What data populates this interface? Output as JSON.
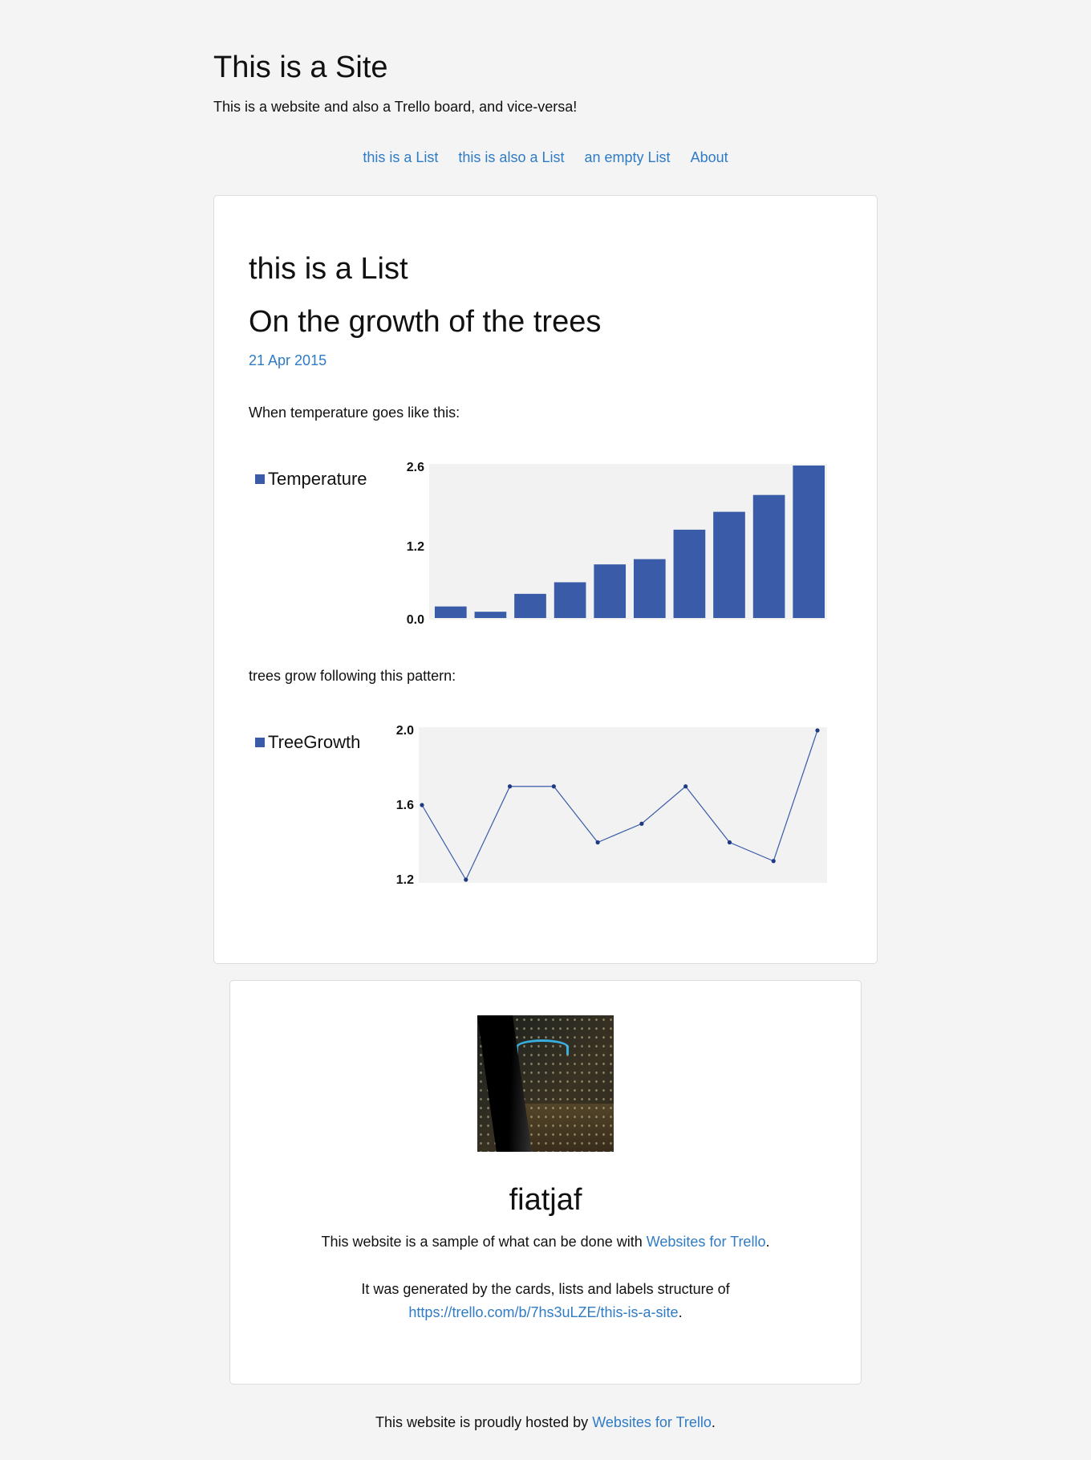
{
  "site": {
    "title": "This is a Site",
    "description": "This is a website and also a Trello board, and vice-versa!"
  },
  "nav": {
    "items": [
      "this is a List",
      "this is also a List",
      "an empty List",
      "About"
    ]
  },
  "list": {
    "title": "this is a List",
    "card": {
      "title": "On the growth of the trees",
      "date": "21 Apr 2015",
      "text1": "When temperature goes like this:",
      "text2": "trees grow following this pattern:"
    }
  },
  "chart_data": [
    {
      "type": "bar",
      "series": [
        {
          "name": "Temperature",
          "values": [
            0.22,
            0.12,
            0.46,
            0.68,
            1.02,
            1.12,
            1.68,
            2.02,
            2.34,
            2.9
          ]
        }
      ],
      "yticks": [
        "2.6",
        "1.2",
        "0.0"
      ],
      "ylim": [
        0,
        2.9
      ],
      "color": "#3a5ba8",
      "background": "#f2f2f2",
      "legend": "left"
    },
    {
      "type": "line",
      "series": [
        {
          "name": "TreeGrowth",
          "values": [
            1.6,
            1.2,
            1.7,
            1.7,
            1.4,
            1.5,
            1.7,
            1.4,
            1.3,
            2.0
          ]
        }
      ],
      "yticks": [
        "2.0",
        "1.6",
        "1.2"
      ],
      "ylim": [
        1.2,
        2.0
      ],
      "color": "#3a5ba8",
      "marker_color": "#1f3a82",
      "background": "#f2f2f2",
      "legend": "left"
    }
  ],
  "profile": {
    "name": "fiatjaf",
    "line1_prefix": "This website is a sample of what can be done with ",
    "line1_link": "Websites for Trello",
    "line1_suffix": ".",
    "line2_prefix": "It was generated by the cards, lists and labels structure of",
    "line2_link": "https://trello.com/b/7hs3uLZE/this-is-a-site",
    "line2_suffix": "."
  },
  "footer": {
    "prefix": "This website is proudly hosted by ",
    "link": "Websites for Trello",
    "suffix": "."
  }
}
